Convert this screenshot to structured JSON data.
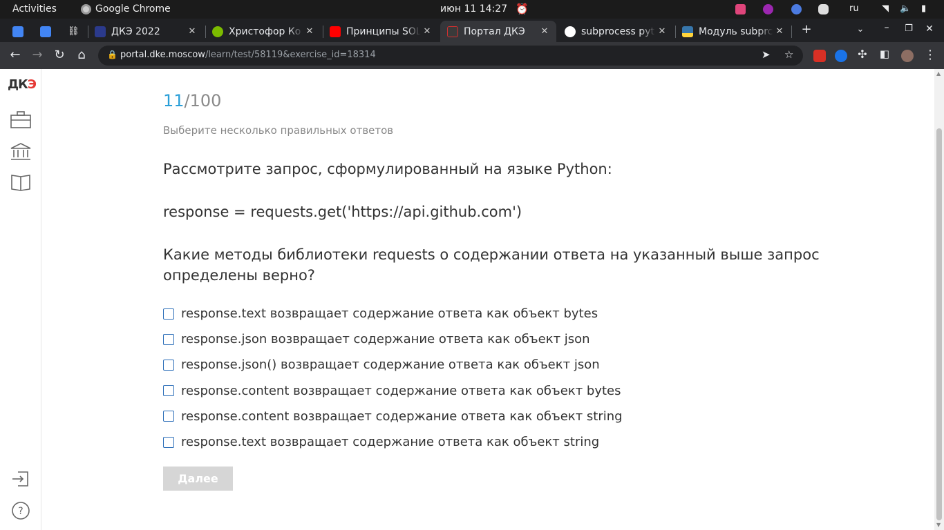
{
  "system_bar": {
    "activities": "Activities",
    "app_name": "Google Chrome",
    "clock": "июн 11  14:27",
    "language": "ru"
  },
  "tabs": [
    {
      "label": "",
      "icon": "google-docs-icon",
      "color": "#4285f4"
    },
    {
      "label": "",
      "icon": "google-docs-icon",
      "color": "#4285f4"
    },
    {
      "label": "",
      "icon": "link-icon",
      "color": "#ffffff"
    },
    {
      "label": "ДКЭ 2022",
      "icon": "dke-icon",
      "color": "#2b3a8c"
    },
    {
      "label": "Христофор Ко",
      "icon": "circle-icon",
      "color": "#7cbb00"
    },
    {
      "label": "Принципы SOL",
      "icon": "youtube-icon",
      "color": "#ff0000"
    },
    {
      "label": "Портал ДКЭ",
      "icon": "dke-portal-icon",
      "color": "#d32f2f"
    },
    {
      "label": "subprocess pyt",
      "icon": "google-icon",
      "color": "#ffffff"
    },
    {
      "label": "Модуль subprc",
      "icon": "python-icon",
      "color": "#3776ab"
    }
  ],
  "address_bar": {
    "host": "portal.dke.moscow",
    "path": "/learn/test/58119&exercise_id=18314"
  },
  "quiz": {
    "current": "11",
    "total": "/100",
    "hint": "Выберите несколько правильных ответов",
    "question_line1": "Рассмотрите запрос, сформулированный на языке Python:",
    "code_line": "response = requests.get('https://api.github.com')",
    "question_line2": "Какие методы библиотеки requests о содержании ответа на указанный выше запрос определены верно?",
    "options": [
      "response.text возвращает содержание ответа как объект bytes",
      "response.json возвращает содержание ответа как объект json",
      "response.json() возвращает содержание ответа как объект json",
      "response.content возвращает содержание ответа как объект bytes",
      "response.content возвращает содержание ответа как объект string",
      "response.text возвращает содержание ответа как объект string"
    ],
    "next_label": "Далее"
  },
  "logo": {
    "left": "ДК",
    "right": "Э"
  },
  "colors": {
    "accent": "#2a9fd8",
    "checkbox_border": "#2a6db8",
    "disabled_button": "#d6d6d6"
  }
}
